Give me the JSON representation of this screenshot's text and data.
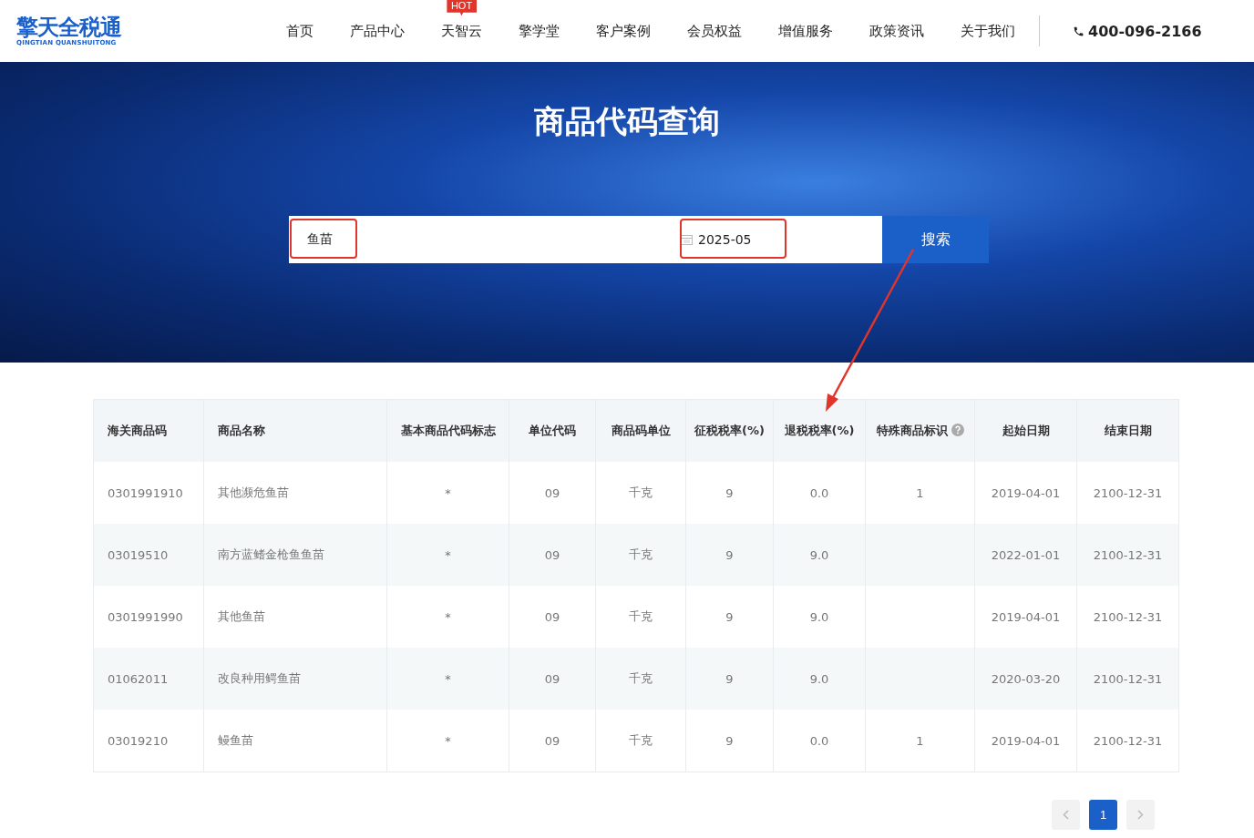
{
  "logo": {
    "name": "擎天全税通",
    "subtitle": "QINGTIAN QUANSHUITONG"
  },
  "nav": [
    {
      "label": "首页"
    },
    {
      "label": "产品中心"
    },
    {
      "label": "天智云",
      "badge": "HOT"
    },
    {
      "label": "擎学堂"
    },
    {
      "label": "客户案例"
    },
    {
      "label": "会员权益"
    },
    {
      "label": "增值服务"
    },
    {
      "label": "政策资讯"
    },
    {
      "label": "关于我们"
    }
  ],
  "phone": "400-096-2166",
  "banner": {
    "title": "商品代码查询"
  },
  "search": {
    "keyword": "鱼苗",
    "date": "2025-05",
    "button": "搜索"
  },
  "table": {
    "columns": [
      "海关商品码",
      "商品名称",
      "基本商品代码标志",
      "单位代码",
      "商品码单位",
      "征税税率(%)",
      "退税税率(%)",
      "特殊商品标识",
      "起始日期",
      "结束日期"
    ],
    "rows": [
      [
        "0301991910",
        "其他濒危鱼苗",
        "*",
        "09",
        "千克",
        "9",
        "0.0",
        "1",
        "2019-04-01",
        "2100-12-31"
      ],
      [
        "03019510",
        "南方蓝鳍金枪鱼鱼苗",
        "*",
        "09",
        "千克",
        "9",
        "9.0",
        "",
        "2022-01-01",
        "2100-12-31"
      ],
      [
        "0301991990",
        "其他鱼苗",
        "*",
        "09",
        "千克",
        "9",
        "9.0",
        "",
        "2019-04-01",
        "2100-12-31"
      ],
      [
        "01062011",
        "改良种用鳄鱼苗",
        "*",
        "09",
        "千克",
        "9",
        "9.0",
        "",
        "2020-03-20",
        "2100-12-31"
      ],
      [
        "03019210",
        "鳗鱼苗",
        "*",
        "09",
        "千克",
        "9",
        "0.0",
        "1",
        "2019-04-01",
        "2100-12-31"
      ]
    ]
  },
  "pagination": [
    {
      "label": "1",
      "selected": true
    }
  ]
}
